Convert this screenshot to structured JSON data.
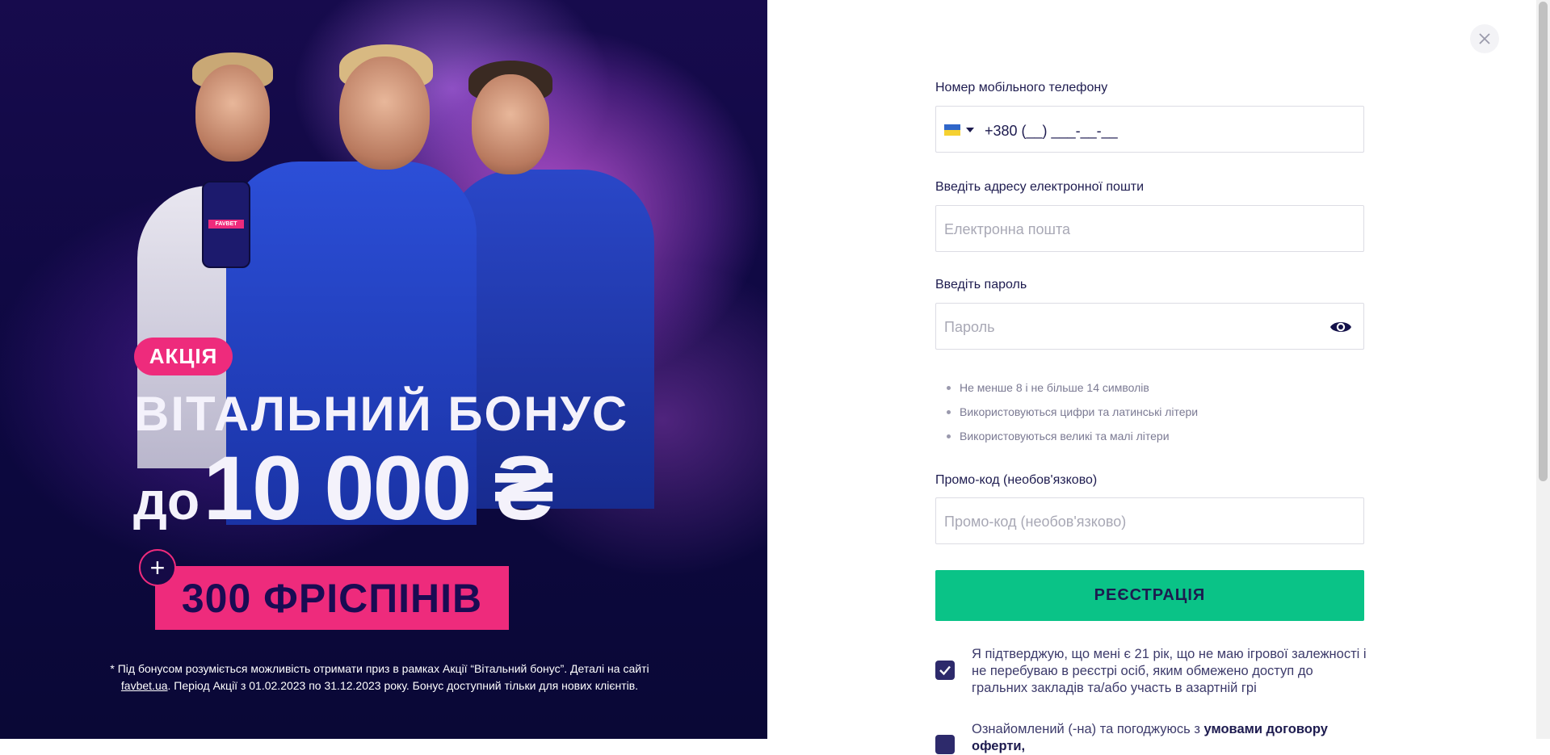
{
  "promo": {
    "badge": "АКЦІЯ",
    "title_line1": "ВІТАЛЬНИЙ БОНУС",
    "title_prefix": "до",
    "title_amount": "10 000 ₴",
    "plus_sign": "+",
    "freespins": "300 ФРІСПІНІВ",
    "phone_brand": "FAVBET",
    "footnote_part1": "* Під бонусом розуміється можливість отримати приз в рамках Акції “Вітальний бонус”. Деталі на сайті",
    "footnote_link": "favbet.ua",
    "footnote_part2": ". Період Акції з 01.02.2023 по 31.12.2023 року. Бонус доступний тільки для нових клієнтів."
  },
  "form": {
    "phone_label": "Номер мобільного телефону",
    "phone_value": "+380 (__) ___-__-__",
    "email_label": "Введіть адресу електронної пошти",
    "email_placeholder": "Електронна пошта",
    "password_label": "Введіть пароль",
    "password_placeholder": "Пароль",
    "password_rules": [
      "Не менше 8 і не більше 14 символів",
      "Використовуються цифри та латинські літери",
      "Використовуються великі та малі літери"
    ],
    "promo_label": "Промо-код (необов'язково)",
    "promo_placeholder": "Промо-код (необов'язково)",
    "register_label": "РЕЄСТРАЦІЯ",
    "consent1": "Я підтверджую, що мені є 21 рік, що не маю ігрової залежності і не перебуваю в реєстрі осіб, яким обмежено доступ до гральних закладів та/або участь в азартній грі",
    "consent2_text": "Ознайомлений (-на) та погоджуюсь з",
    "consent2_bold": "умовами договору оферти,",
    "consent1_checked": true,
    "consent2_checked": true
  },
  "icons": {
    "close": "close-icon",
    "eye": "eye-icon",
    "flag": "ukraine-flag-icon",
    "check": "check-icon"
  },
  "colors": {
    "accent_pink": "#ee2b7c",
    "button_green": "#0ac387",
    "navy": "#1d1b4f"
  }
}
